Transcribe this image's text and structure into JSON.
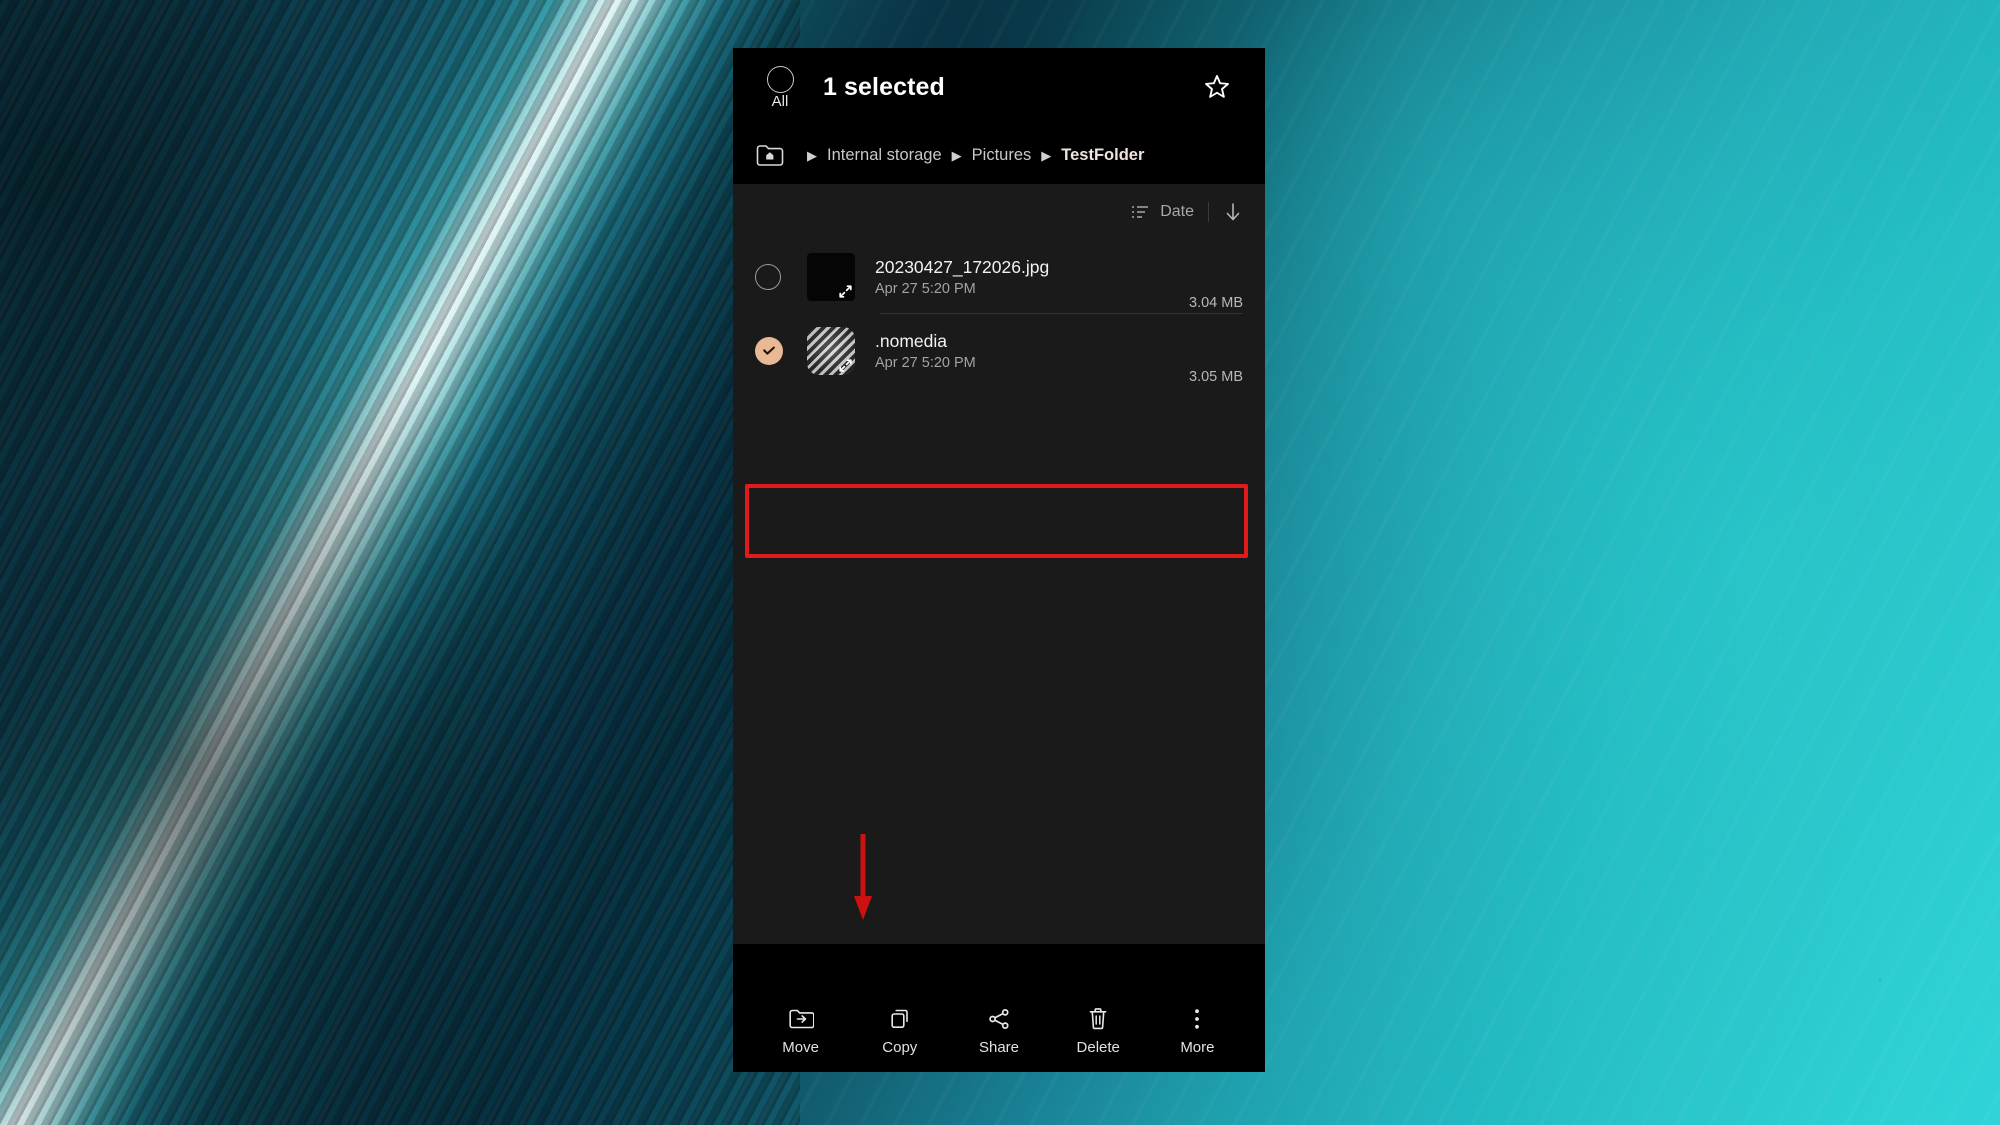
{
  "header": {
    "select_all": {
      "label": "All",
      "icon": "circle-unchecked-icon"
    },
    "title": "1 selected",
    "favorite_icon": "star-icon"
  },
  "breadcrumb": {
    "home_icon": "home-folder-icon",
    "separator": "▶",
    "items": [
      {
        "label": "Internal storage",
        "current": false
      },
      {
        "label": "Pictures",
        "current": false
      },
      {
        "label": "TestFolder",
        "current": true
      }
    ]
  },
  "sort": {
    "icon": "sort-icon",
    "label": "Date",
    "direction_icon": "arrow-down-icon"
  },
  "files": [
    {
      "name": "20230427_172026.jpg",
      "date": "Apr 27 5:20 PM",
      "size": "3.04 MB",
      "selected": false,
      "thumbnail": "black-image-thumbnail",
      "expand_icon": "expand-icon"
    },
    {
      "name": ".nomedia",
      "date": "Apr 27 5:20 PM",
      "size": "3.05 MB",
      "selected": true,
      "thumbnail": "hatched-placeholder-thumbnail",
      "expand_icon": "expand-icon"
    }
  ],
  "toolbar": [
    {
      "label": "Move",
      "icon": "move-to-folder-icon"
    },
    {
      "label": "Copy",
      "icon": "copy-icon"
    },
    {
      "label": "Share",
      "icon": "share-icon"
    },
    {
      "label": "Delete",
      "icon": "trash-icon"
    },
    {
      "label": "More",
      "icon": "overflow-menu-icon"
    }
  ],
  "annotations": {
    "highlight_box": {
      "target": ".nomedia",
      "color": "#e01b1b"
    },
    "pointer_arrow": {
      "target": "Delete",
      "color": "#cc1111",
      "direction": "down"
    }
  },
  "colors": {
    "panel_header_bg": "#000000",
    "list_bg": "#1a1a1a",
    "selection_accent": "#e9b894",
    "annotation_red": "#e01b1b"
  }
}
